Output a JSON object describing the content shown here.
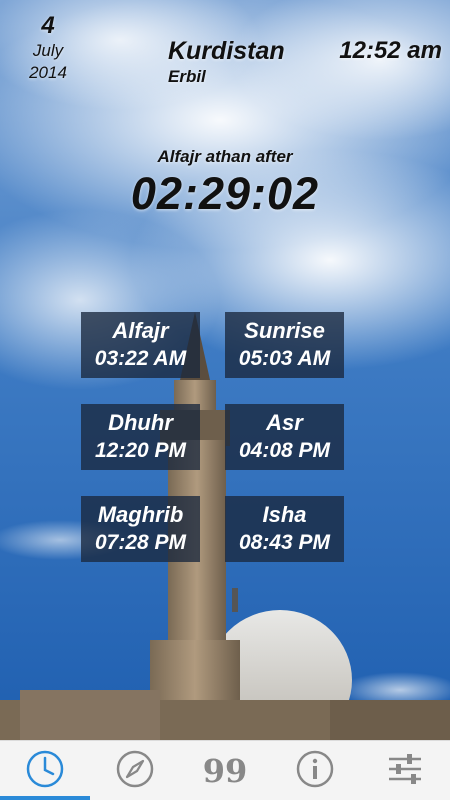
{
  "header": {
    "day": "4",
    "month": "July",
    "year": "2014",
    "region": "Kurdistan",
    "city": "Erbil",
    "clock": "12:52 am"
  },
  "countdown": {
    "label": "Alfajr athan after",
    "value": "02:29:02"
  },
  "prayers": [
    {
      "name": "Alfajr",
      "time": "03:22 AM"
    },
    {
      "name": "Sunrise",
      "time": "05:03 AM"
    },
    {
      "name": "Dhuhr",
      "time": "12:20 PM"
    },
    {
      "name": "Asr",
      "time": "04:08 PM"
    },
    {
      "name": "Maghrib",
      "time": "07:28 PM"
    },
    {
      "name": "Isha",
      "time": "08:43 PM"
    }
  ],
  "nav": {
    "items": [
      {
        "icon": "clock-icon",
        "active": true
      },
      {
        "icon": "compass-icon",
        "active": false
      },
      {
        "icon": "tasbih-99-icon",
        "label": "99",
        "active": false
      },
      {
        "icon": "info-icon",
        "active": false
      },
      {
        "icon": "settings-sliders-icon",
        "active": false
      }
    ]
  },
  "colors": {
    "accent": "#2a8ad8",
    "card_bg": "#19283e",
    "sky": "#2d6ab5"
  }
}
